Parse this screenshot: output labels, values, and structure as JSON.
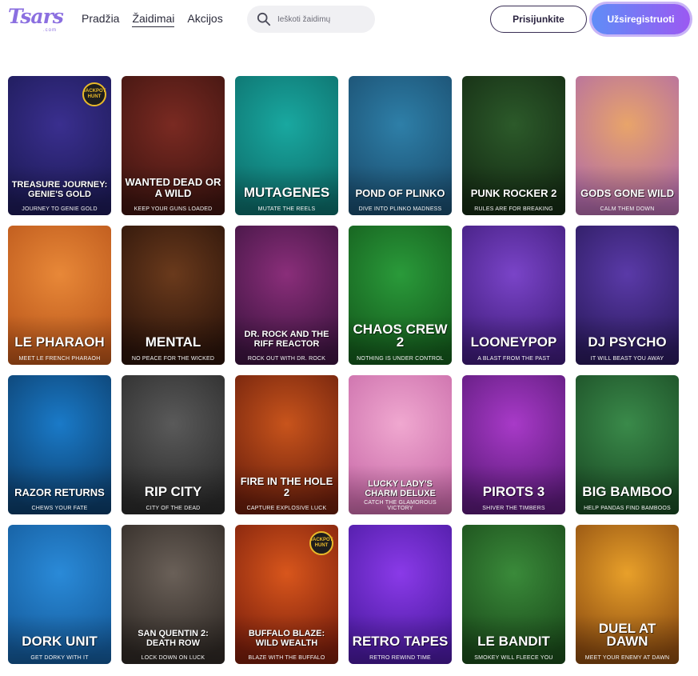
{
  "header": {
    "logo_text": "Tsars",
    "logo_sub": ".com",
    "nav": [
      {
        "label": "Pradžia",
        "active": false
      },
      {
        "label": "Žaidimai",
        "active": true
      },
      {
        "label": "Akcijos",
        "active": false
      }
    ],
    "search_placeholder": "Ieškoti žaidimų",
    "login_label": "Prisijunkite",
    "register_label": "Užsiregistruoti"
  },
  "colors": {
    "brand": "#8b6fe0",
    "register_gradient_start": "#5f8df7",
    "register_gradient_end": "#9b59f2"
  },
  "games": [
    {
      "title": "Treasure Journey: Genie's Gold",
      "sub": "Journey to Genie Gold",
      "badge": "JACKPOT HUNT",
      "bg": "#3a2f8f",
      "bg2": "#1c1a55"
    },
    {
      "title": "Wanted Dead or a Wild",
      "sub": "Keep your guns loaded",
      "bg": "#7a2a22",
      "bg2": "#3e1410"
    },
    {
      "title": "Mutagenes",
      "sub": "Mutate the reels",
      "bg": "#19a8a0",
      "bg2": "#0d6d6a"
    },
    {
      "title": "Pond of Plinko",
      "sub": "Dive into Plinko madness",
      "bg": "#2e7fa8",
      "bg2": "#1a4c6d"
    },
    {
      "title": "Punk Rocker 2",
      "sub": "Rules are for breaking",
      "bg": "#2c5a2a",
      "bg2": "#142a13"
    },
    {
      "title": "Gods Gone Wild",
      "sub": "Calm them down",
      "bg": "#e8a46a",
      "bg2": "#b06aa8"
    },
    {
      "title": "Le Pharaoh",
      "sub": "Meet Le French Pharaoh",
      "bg": "#e88838",
      "bg2": "#b9551a"
    },
    {
      "title": "Mental",
      "sub": "No peace for the wicked",
      "bg": "#6a3a1c",
      "bg2": "#2a130a"
    },
    {
      "title": "Dr. Rock and the Riff Reactor",
      "sub": "Rock out with Dr. Rock",
      "bg": "#8a2e7a",
      "bg2": "#3d1440"
    },
    {
      "title": "Chaos Crew 2",
      "sub": "Nothing is under control",
      "bg": "#2a9a3a",
      "bg2": "#145a1c"
    },
    {
      "title": "LooneyPop",
      "sub": "A blast from the past",
      "bg": "#7a44c8",
      "bg2": "#3f1c7a"
    },
    {
      "title": "DJ Psycho",
      "sub": "It will beast you away",
      "bg": "#5a3aa8",
      "bg2": "#2a1a5c"
    },
    {
      "title": "Razor Returns",
      "sub": "Chews your fate",
      "bg": "#1a7ac8",
      "bg2": "#0c3d6a"
    },
    {
      "title": "Rip City",
      "sub": "City of the dead",
      "bg": "#5a5a5a",
      "bg2": "#2a2a2a"
    },
    {
      "title": "Fire in the Hole 2",
      "sub": "Capture explosive luck",
      "bg": "#c8541c",
      "bg2": "#6a1e0c"
    },
    {
      "title": "Lucky Lady's Charm Deluxe",
      "sub": "Catch the glamorous victory",
      "bg": "#f0a8d0",
      "bg2": "#c86aa8"
    },
    {
      "title": "Pirots 3",
      "sub": "Shiver the timbers",
      "bg": "#a83ac8",
      "bg2": "#5a1a78"
    },
    {
      "title": "Big Bamboo",
      "sub": "Help pandas find bamboos",
      "bg": "#3a8a4a",
      "bg2": "#1a4a24"
    },
    {
      "title": "Dork Unit",
      "sub": "Get dorky with it",
      "bg": "#2a8ad8",
      "bg2": "#145a9a"
    },
    {
      "title": "San Quentin 2: Death Row",
      "sub": "Lock down on luck",
      "bg": "#6a6058",
      "bg2": "#2e2824"
    },
    {
      "title": "Buffalo Blaze: Wild Wealth",
      "sub": "Blaze with the buffalo",
      "badge": "JACKPOT HUNT",
      "bg": "#d8561c",
      "bg2": "#7a1e0c"
    },
    {
      "title": "Retro Tapes",
      "sub": "Retro rewind time",
      "bg": "#8a3ae8",
      "bg2": "#4a1aa0"
    },
    {
      "title": "Le Bandit",
      "sub": "Smokey will fleece you",
      "bg": "#3a8a3a",
      "bg2": "#1a4a1a"
    },
    {
      "title": "Duel at Dawn",
      "sub": "Meet your enemy at dawn",
      "bg": "#e8a02a",
      "bg2": "#8a4a10"
    }
  ]
}
